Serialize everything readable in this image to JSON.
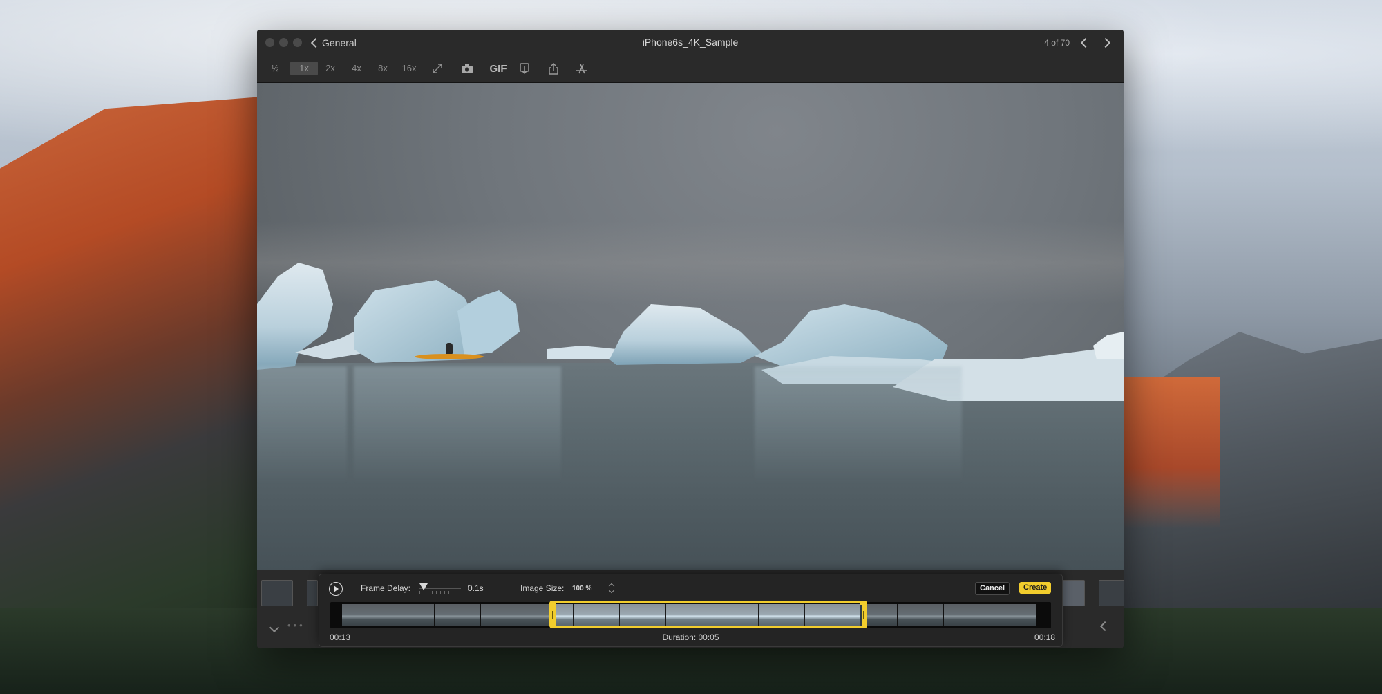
{
  "window": {
    "back_label": "General",
    "title": "iPhone6s_4K_Sample",
    "counter": "4 of 70"
  },
  "toolbar": {
    "zoom_levels": [
      "½",
      "1x",
      "2x",
      "4x",
      "8x",
      "16x"
    ],
    "active_zoom": "1x",
    "gif_label": "GIF",
    "icons": [
      "fullscreen-icon",
      "camera-icon",
      "gif-icon",
      "export-icon",
      "share-icon",
      "app-store-icon"
    ]
  },
  "gif_panel": {
    "frame_delay_label": "Frame Delay:",
    "frame_delay_value": "0.1s",
    "image_size_label": "Image Size:",
    "image_size_value": "100 %",
    "cancel_label": "Cancel",
    "create_label": "Create",
    "start_time": "00:13",
    "duration_label": "Duration: 00:05",
    "end_time": "00:18"
  },
  "colors": {
    "accent": "#f2cd2d",
    "window_bg": "#1e1e1e",
    "toolbar_bg": "#2a2a2a"
  }
}
